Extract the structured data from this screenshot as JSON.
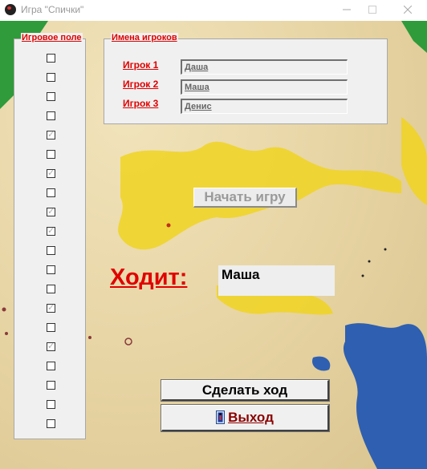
{
  "window": {
    "title": "Игра \"Спички\""
  },
  "game_field": {
    "legend": "Игровое поле",
    "matches": [
      false,
      false,
      false,
      false,
      true,
      false,
      true,
      false,
      true,
      true,
      false,
      false,
      false,
      true,
      false,
      true,
      false,
      false,
      false,
      false
    ]
  },
  "players": {
    "legend": "Имена игроков",
    "items": [
      {
        "label": "Игрок 1",
        "name": "Даша"
      },
      {
        "label": "Игрок 2",
        "name": "Маша"
      },
      {
        "label": "Игрок 3",
        "name": "Денис"
      }
    ]
  },
  "start_button": {
    "label": "Начать игру"
  },
  "turn": {
    "label": "Ходит:",
    "current_player": "Маша"
  },
  "move_button": {
    "label": "Сделать ход"
  },
  "exit_button": {
    "label": "Выход",
    "icon": "door-exit-icon"
  },
  "colors": {
    "label_red": "#e00000",
    "exit_text": "#8b0000",
    "splash_yellow": "#f0d421",
    "splash_blue": "#2f5fb0",
    "splash_green": "#2f9b3a"
  }
}
